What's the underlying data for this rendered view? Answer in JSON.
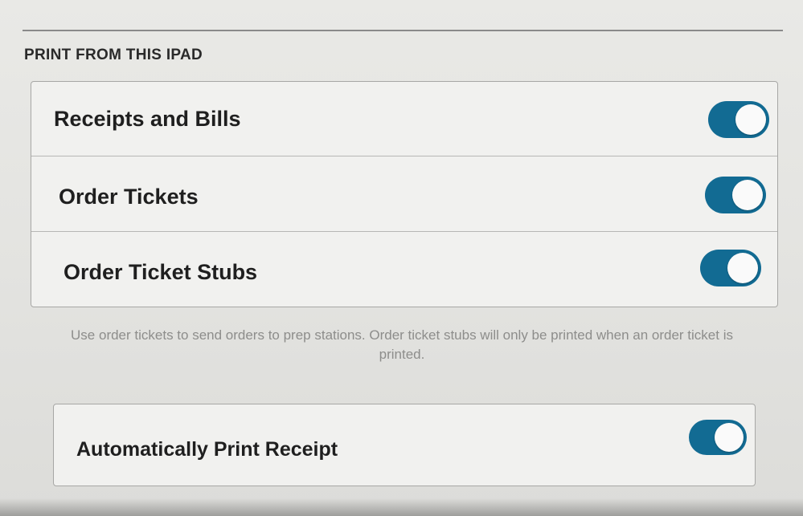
{
  "section": {
    "title": "PRINT FROM THIS IPAD"
  },
  "print_items": [
    {
      "label": "Receipts and Bills",
      "enabled": true
    },
    {
      "label": "Order Tickets",
      "enabled": true
    },
    {
      "label": "Order Ticket Stubs",
      "enabled": true
    }
  ],
  "helper_text": "Use order tickets to send orders to prep stations. Order ticket stubs will only be printed when an order ticket is printed.",
  "auto_print": {
    "label": "Automatically Print Receipt",
    "enabled": true
  },
  "colors": {
    "toggle_on": "#126b93",
    "background": "#e6e6e3",
    "card": "#f1f1ef"
  }
}
